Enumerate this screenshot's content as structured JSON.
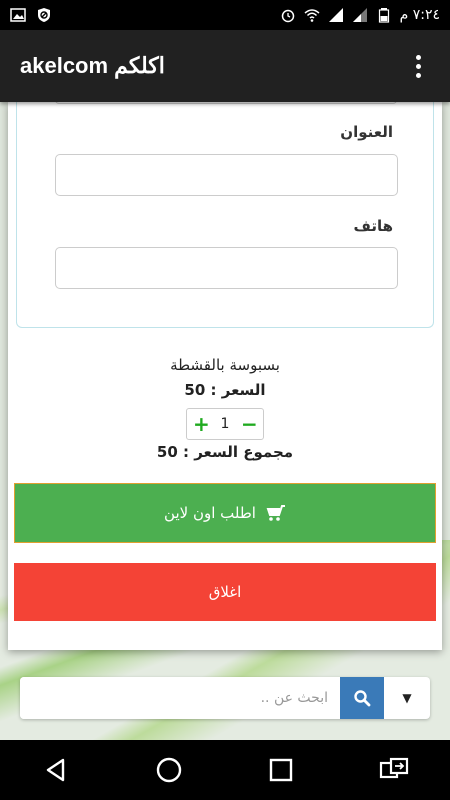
{
  "status_bar": {
    "time": "٧:٢٤ م",
    "icons": [
      "image-icon",
      "blocked-app-icon",
      "alarm-icon",
      "wifi-icon",
      "signal-icon",
      "signal-2-icon",
      "battery-icon"
    ]
  },
  "app_bar": {
    "title": "akelcom اكلكم",
    "menu_icon": "overflow-menu-icon"
  },
  "form": {
    "address_label": "العنوان",
    "address_value": "",
    "phone_label": "هاتف",
    "phone_value": ""
  },
  "product": {
    "name": "بسبوسة بالقشطة",
    "price_text": "السعر : 50",
    "quantity": "1",
    "total_text": "مجموع السعر : 50"
  },
  "buttons": {
    "order_label": "اطلب اون لاين",
    "order_icon": "cart-icon",
    "close_label": "اغلاق"
  },
  "search": {
    "placeholder": "ابحث عن ..",
    "value": ""
  },
  "colors": {
    "app_bar": "#212121",
    "order_button": "#4caf50",
    "close_button": "#f44336",
    "search_button": "#3a7ab8",
    "stepper": "#1faa1f"
  }
}
